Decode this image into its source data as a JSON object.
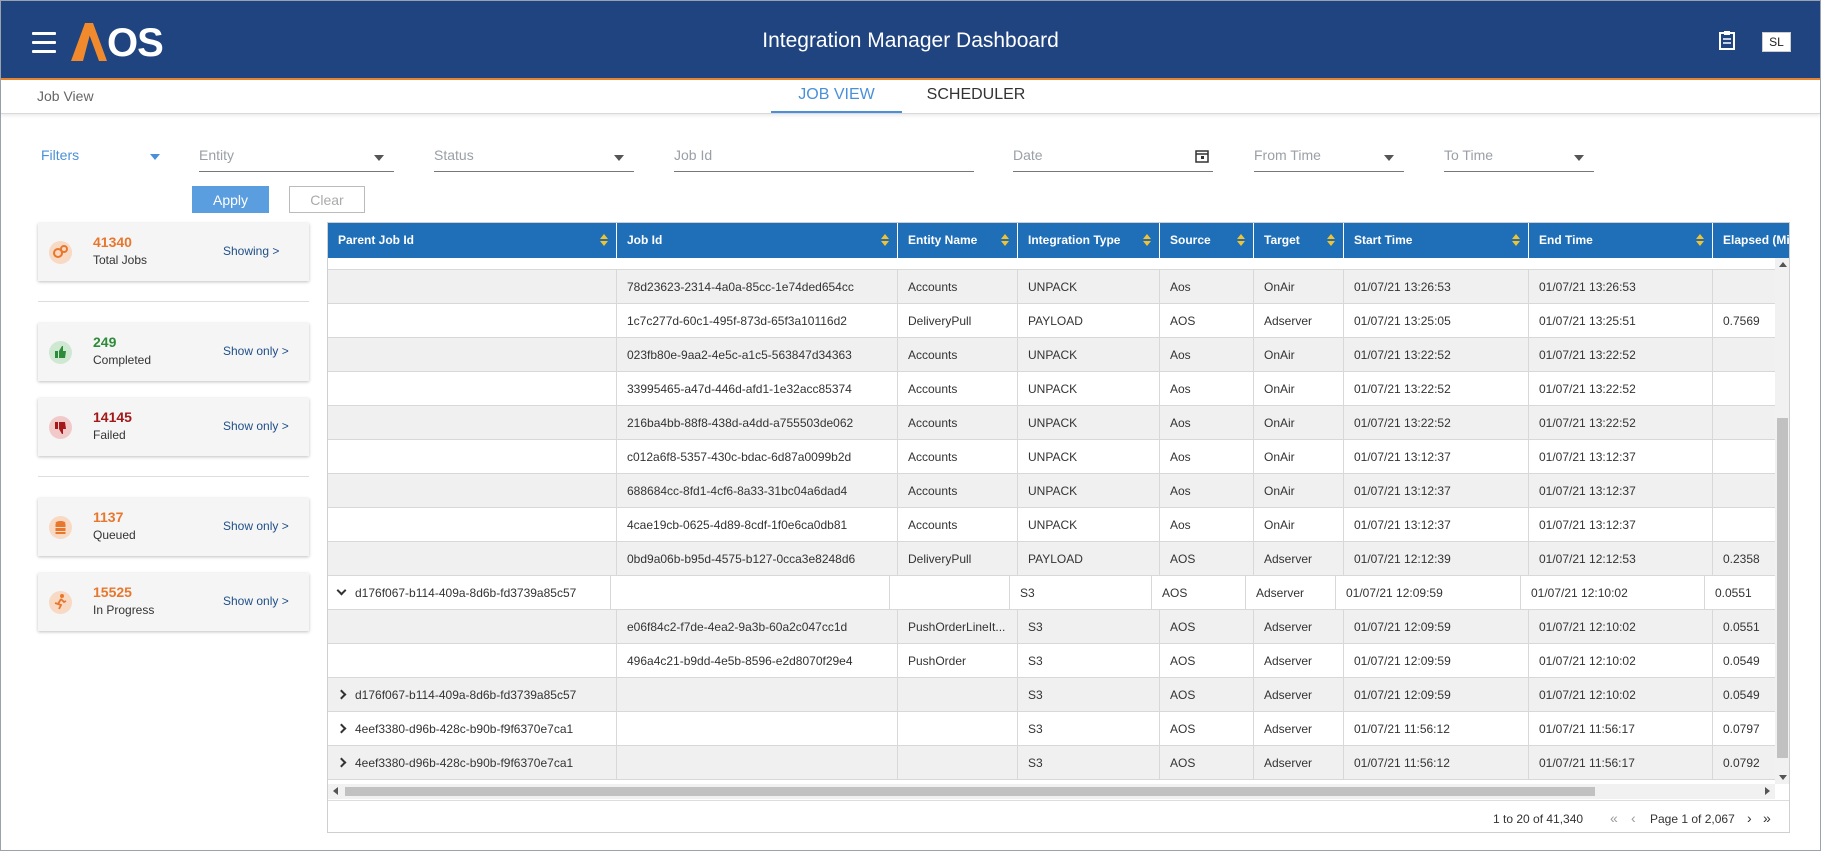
{
  "header": {
    "logo_text": "AOS",
    "title": "Integration Manager Dashboard",
    "user_initials": "SL"
  },
  "subnav": {
    "breadcrumb": "Job View",
    "tabs": [
      {
        "label": "JOB VIEW",
        "active": true
      },
      {
        "label": "SCHEDULER",
        "active": false
      }
    ]
  },
  "filters": {
    "label": "Filters",
    "entity_placeholder": "Entity",
    "status_placeholder": "Status",
    "jobid_placeholder": "Job Id",
    "date_placeholder": "Date",
    "from_time_placeholder": "From Time",
    "to_time_placeholder": "To Time",
    "apply_label": "Apply",
    "clear_label": "Clear"
  },
  "stats": [
    {
      "count": "41340",
      "label": "Total Jobs",
      "action": "Showing >",
      "color": "#e8772e",
      "icon": "gears-icon"
    },
    {
      "count": "249",
      "label": "Completed",
      "action": "Show only >",
      "color": "#2e8b3a",
      "icon": "thumbs-up-icon"
    },
    {
      "count": "14145",
      "label": "Failed",
      "action": "Show only >",
      "color": "#a31818",
      "icon": "thumbs-down-icon"
    },
    {
      "count": "1137",
      "label": "Queued",
      "action": "Show only >",
      "color": "#e8772e",
      "icon": "database-icon"
    },
    {
      "count": "15525",
      "label": "In Progress",
      "action": "Show only >",
      "color": "#e8772e",
      "icon": "running-icon"
    }
  ],
  "grid": {
    "columns": [
      "Parent Job Id",
      "Job Id",
      "Entity Name",
      "Integration Type",
      "Source",
      "Target",
      "Start Time",
      "End Time",
      "Elapsed (Min"
    ],
    "rows": [
      {
        "parent": "",
        "job": "78d23623-2314-4a0a-85cc-1e74ded654cc",
        "entity": "Accounts",
        "type": "UNPACK",
        "source": "Aos",
        "target": "OnAir",
        "start": "01/07/21 13:26:53",
        "end": "01/07/21 13:26:53",
        "elapsed": ""
      },
      {
        "parent": "",
        "job": "1c7c277d-60c1-495f-873d-65f3a10116d2",
        "entity": "DeliveryPull",
        "type": "PAYLOAD",
        "source": "AOS",
        "target": "Adserver",
        "start": "01/07/21 13:25:05",
        "end": "01/07/21 13:25:51",
        "elapsed": "0.7569"
      },
      {
        "parent": "",
        "job": "023fb80e-9aa2-4e5c-a1c5-563847d34363",
        "entity": "Accounts",
        "type": "UNPACK",
        "source": "Aos",
        "target": "OnAir",
        "start": "01/07/21 13:22:52",
        "end": "01/07/21 13:22:52",
        "elapsed": ""
      },
      {
        "parent": "",
        "job": "33995465-a47d-446d-afd1-1e32acc85374",
        "entity": "Accounts",
        "type": "UNPACK",
        "source": "Aos",
        "target": "OnAir",
        "start": "01/07/21 13:22:52",
        "end": "01/07/21 13:22:52",
        "elapsed": ""
      },
      {
        "parent": "",
        "job": "216ba4bb-88f8-438d-a4dd-a755503de062",
        "entity": "Accounts",
        "type": "UNPACK",
        "source": "Aos",
        "target": "OnAir",
        "start": "01/07/21 13:22:52",
        "end": "01/07/21 13:22:52",
        "elapsed": ""
      },
      {
        "parent": "",
        "job": "c012a6f8-5357-430c-bdac-6d87a0099b2d",
        "entity": "Accounts",
        "type": "UNPACK",
        "source": "Aos",
        "target": "OnAir",
        "start": "01/07/21 13:12:37",
        "end": "01/07/21 13:12:37",
        "elapsed": ""
      },
      {
        "parent": "",
        "job": "688684cc-8fd1-4cf6-8a33-31bc04a6dad4",
        "entity": "Accounts",
        "type": "UNPACK",
        "source": "Aos",
        "target": "OnAir",
        "start": "01/07/21 13:12:37",
        "end": "01/07/21 13:12:37",
        "elapsed": ""
      },
      {
        "parent": "",
        "job": "4cae19cb-0625-4d89-8cdf-1f0e6ca0db81",
        "entity": "Accounts",
        "type": "UNPACK",
        "source": "Aos",
        "target": "OnAir",
        "start": "01/07/21 13:12:37",
        "end": "01/07/21 13:12:37",
        "elapsed": ""
      },
      {
        "parent": "",
        "job": "0bd9a06b-b95d-4575-b127-0cca3e8248d6",
        "entity": "DeliveryPull",
        "type": "PAYLOAD",
        "source": "AOS",
        "target": "Adserver",
        "start": "01/07/21 12:12:39",
        "end": "01/07/21 12:12:53",
        "elapsed": "0.2358"
      },
      {
        "parent": "d176f067-b114-409a-8d6b-fd3739a85c57",
        "expanded": true,
        "job": "",
        "entity": "",
        "type": "S3",
        "source": "AOS",
        "target": "Adserver",
        "start": "01/07/21 12:09:59",
        "end": "01/07/21 12:10:02",
        "elapsed": "0.0551"
      },
      {
        "parent": "",
        "job": "e06f84c2-f7de-4ea2-9a3b-60a2c047cc1d",
        "entity": "PushOrderLineIt...",
        "type": "S3",
        "source": "AOS",
        "target": "Adserver",
        "start": "01/07/21 12:09:59",
        "end": "01/07/21 12:10:02",
        "elapsed": "0.0551"
      },
      {
        "parent": "",
        "job": "496a4c21-b9dd-4e5b-8596-e2d8070f29e4",
        "entity": "PushOrder",
        "type": "S3",
        "source": "AOS",
        "target": "Adserver",
        "start": "01/07/21 12:09:59",
        "end": "01/07/21 12:10:02",
        "elapsed": "0.0549"
      },
      {
        "parent": "d176f067-b114-409a-8d6b-fd3739a85c57",
        "expanded": false,
        "job": "",
        "entity": "",
        "type": "S3",
        "source": "AOS",
        "target": "Adserver",
        "start": "01/07/21 12:09:59",
        "end": "01/07/21 12:10:02",
        "elapsed": "0.0549"
      },
      {
        "parent": "4eef3380-d96b-428c-b90b-f9f6370e7ca1",
        "expanded": false,
        "job": "",
        "entity": "",
        "type": "S3",
        "source": "AOS",
        "target": "Adserver",
        "start": "01/07/21 11:56:12",
        "end": "01/07/21 11:56:17",
        "elapsed": "0.0797"
      },
      {
        "parent": "4eef3380-d96b-428c-b90b-f9f6370e7ca1",
        "expanded": false,
        "job": "",
        "entity": "",
        "type": "S3",
        "source": "AOS",
        "target": "Adserver",
        "start": "01/07/21 11:56:12",
        "end": "01/07/21 11:56:17",
        "elapsed": "0.0792"
      }
    ]
  },
  "pager": {
    "summary": "1 to 20 of 41,340",
    "page_text": "Page 1 of 2,067"
  },
  "colors": {
    "header_bg": "#1f4480",
    "accent": "#e7842f",
    "grid_header_bg": "#1f6fb8",
    "link_blue": "#4a90d9"
  }
}
